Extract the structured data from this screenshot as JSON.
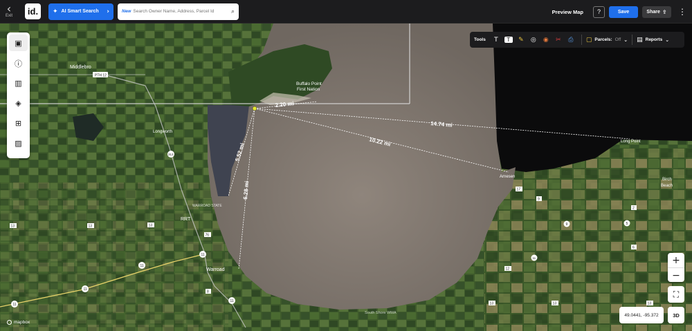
{
  "topbar": {
    "exit_label": "Exit",
    "logo_text": "id.",
    "ai_search_label": "AI Smart Search",
    "search_new_badge": "New",
    "search_placeholder": "Search Owner Name, Address, Parcel Id",
    "preview_map_label": "Preview Map",
    "help_label": "?",
    "save_label": "Save",
    "share_label": "Share"
  },
  "tools": {
    "label": "Tools",
    "parcels_label": "Parcels:",
    "parcels_state": "Off",
    "reports_label": "Reports"
  },
  "map": {
    "labels": {
      "middlebro": "Middlebro",
      "buffalo_point_1": "Buffalo Point",
      "buffalo_point_2": "First Nation",
      "longworth": "Longworth",
      "warroad_state": "WARROAD STATE",
      "rrt": "RRT",
      "warroad": "Warroad",
      "long_point": "Long Point",
      "arnesen": "Arnesen",
      "birch_beach_1": "Birch",
      "birch_beach_2": "Beach",
      "south_shore": "South Shore WMA"
    },
    "measurements": [
      "2.20 mi",
      "14.74 mi",
      "10.22 mi",
      "5.52 mi",
      "6.28 mi"
    ],
    "road_shields": [
      "PTH 12",
      "313",
      "11",
      "11",
      "11",
      "11",
      "13",
      "13",
      "13",
      "76",
      "8",
      "11",
      "17",
      "9",
      "9",
      "2",
      "5",
      "12",
      "13",
      "13",
      "6",
      "11",
      "13",
      "17",
      "5",
      "8",
      "13"
    ],
    "coordinates": "49.0441, -95.372",
    "view_3d_label": "3D",
    "attribution": "mapbox"
  },
  "colors": {
    "accent": "#1f6feb",
    "topbar_bg": "#1c1c1e",
    "lake": "#8a7f78",
    "land": "#3d5a2a"
  }
}
